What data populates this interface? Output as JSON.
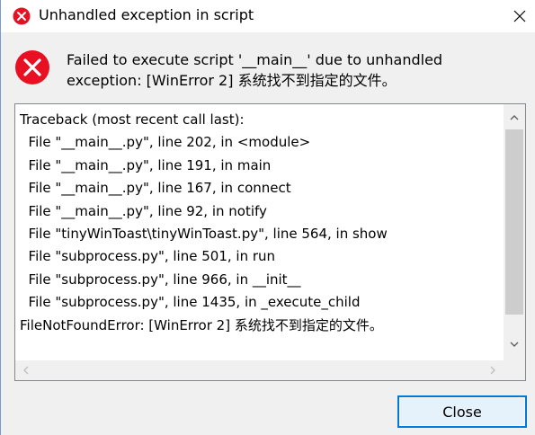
{
  "window": {
    "title": "Unhandled exception in script",
    "title_icon": "error-icon",
    "close_icon": "close-icon"
  },
  "message": {
    "icon": "error-icon",
    "line1": "Failed to execute script '__main__' due to unhandled",
    "line2": "exception: [WinError 2] 系统找不到指定的文件。"
  },
  "traceback": {
    "lines": [
      "Traceback (most recent call last):",
      "  File \"__main__.py\", line 202, in <module>",
      "  File \"__main__.py\", line 191, in main",
      "  File \"__main__.py\", line 167, in connect",
      "  File \"__main__.py\", line 92, in notify",
      "  File \"tinyWinToast\\tinyWinToast.py\", line 564, in show",
      "  File \"subprocess.py\", line 501, in run",
      "  File \"subprocess.py\", line 966, in __init__",
      "  File \"subprocess.py\", line 1435, in _execute_child",
      "FileNotFoundError: [WinError 2] 系统找不到指定的文件。"
    ]
  },
  "buttons": {
    "close_label": "Close"
  },
  "colors": {
    "error_red": "#e81123",
    "button_border": "#0078d7",
    "button_bg": "#e5f1fb"
  }
}
